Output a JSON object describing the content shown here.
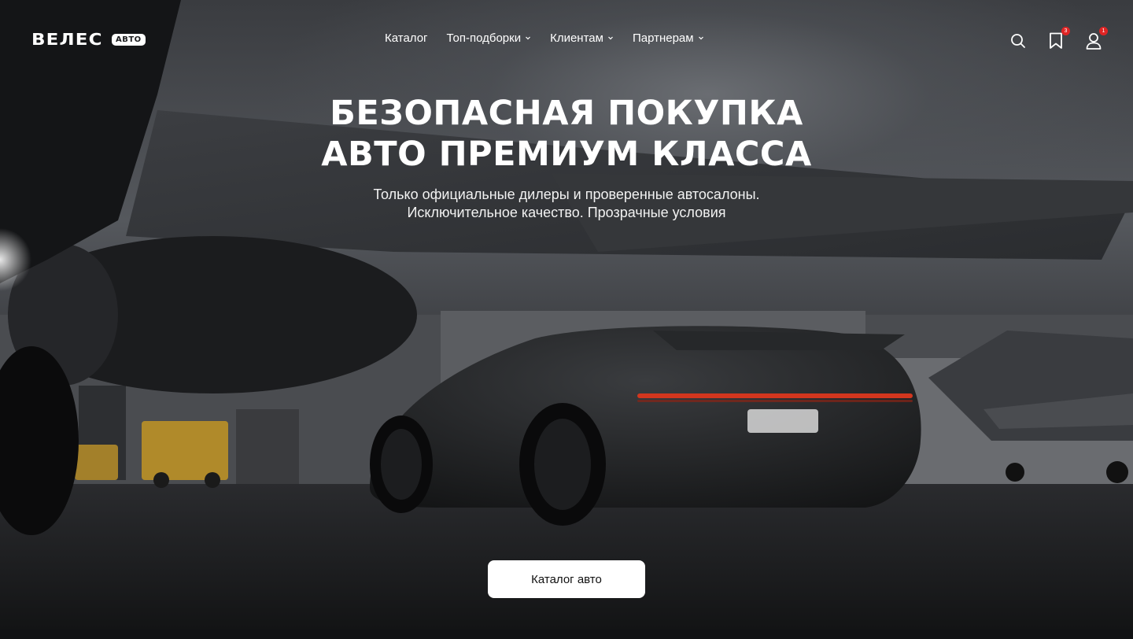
{
  "brand": {
    "name": "ВЕЛЕС",
    "badge": "АВТО"
  },
  "nav": {
    "items": [
      {
        "label": "Каталог",
        "has_dropdown": false
      },
      {
        "label": "Топ-подборки",
        "has_dropdown": true
      },
      {
        "label": "Клиентам",
        "has_dropdown": true
      },
      {
        "label": "Партнерам",
        "has_dropdown": true
      }
    ]
  },
  "header_icons": {
    "search": {
      "icon": "search-icon"
    },
    "bookmarks": {
      "icon": "bookmark-icon",
      "count": "3"
    },
    "profile": {
      "icon": "user-icon",
      "count": "1"
    }
  },
  "hero": {
    "title_line1": "БЕЗОПАСНАЯ ПОКУПКА",
    "title_line2": "АВТО ПРЕМИУМ КЛАССА",
    "subtitle_line1": "Только официальные дилеры и проверенные автосалоны.",
    "subtitle_line2": "Исключительное качество. Прозрачные условия",
    "cta_label": "Каталог авто"
  },
  "colors": {
    "badge_red": "#e02424",
    "cta_bg": "#ffffff",
    "text": "#ffffff"
  }
}
